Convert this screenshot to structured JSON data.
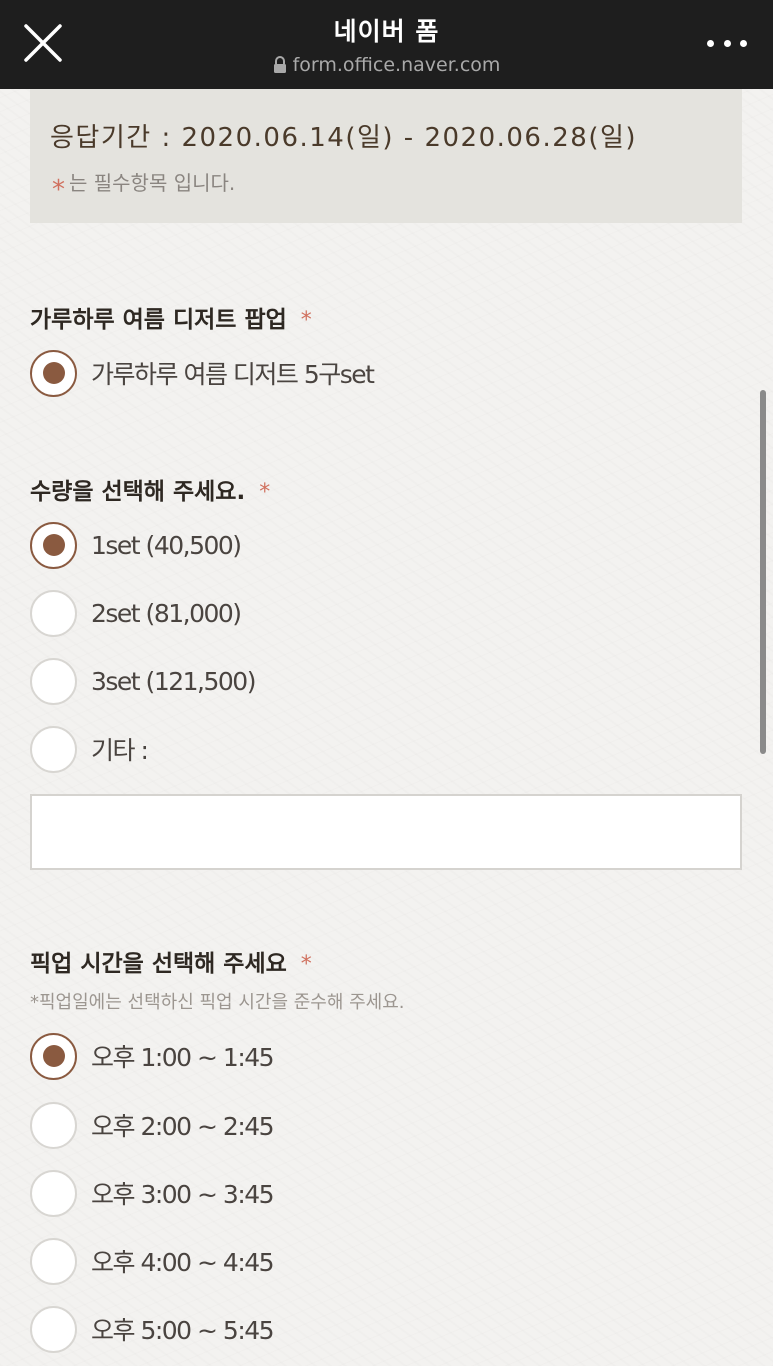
{
  "header": {
    "title": "네이버 폼",
    "url": "form.office.naver.com"
  },
  "notice": {
    "period": "응답기간 : 2020.06.14(일) - 2020.06.28(일)",
    "required_mark": "*",
    "required_text": "는 필수항목 입니다."
  },
  "q1": {
    "title": "가루하루 여름 디저트 팝업",
    "required": "*",
    "options": [
      {
        "label": "가루하루 여름 디저트 5구set",
        "checked": true
      }
    ]
  },
  "q2": {
    "title": "수량을 선택해 주세요.",
    "required": "*",
    "options": [
      {
        "label": "1set (40,500)",
        "checked": true
      },
      {
        "label": "2set (81,000)",
        "checked": false
      },
      {
        "label": "3set (121,500)",
        "checked": false
      },
      {
        "label": "기타 :",
        "checked": false
      }
    ],
    "other_input_value": ""
  },
  "q3": {
    "title": "픽업 시간을 선택해 주세요",
    "required": "*",
    "hint": "*픽업일에는 선택하신 픽업 시간을 준수해 주세요.",
    "options": [
      {
        "label": "오후 1:00 ~ 1:45",
        "checked": true
      },
      {
        "label": "오후 2:00 ~ 2:45",
        "checked": false
      },
      {
        "label": "오후 3:00 ~ 3:45",
        "checked": false
      },
      {
        "label": "오후 4:00 ~ 4:45",
        "checked": false
      },
      {
        "label": "오후 5:00 ~ 5:45",
        "checked": false
      }
    ]
  },
  "colors": {
    "accent": "#8a5a40",
    "required": "#d0705e",
    "topbar": "#1e1e1e"
  },
  "icons": {
    "close": "close-icon",
    "lock": "lock-icon",
    "more": "more-icon"
  }
}
